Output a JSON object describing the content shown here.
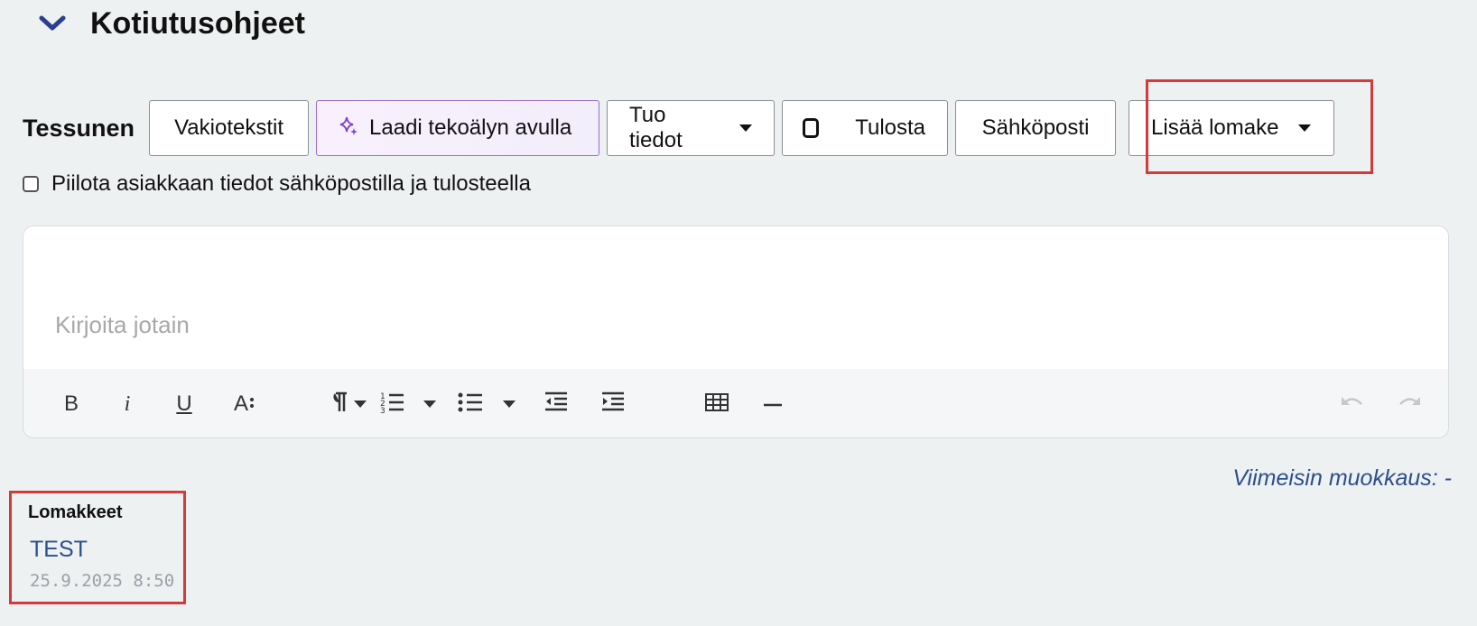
{
  "section": {
    "title": "Kotiutusohjeet",
    "toggle_icon": "chevron-down-icon"
  },
  "toolbar": {
    "label": "Tessunen",
    "buttons": {
      "standard_texts": "Vakiotekstit",
      "ai_compose": "Laadi tekoälyn avulla",
      "import_data": "Tuo tiedot",
      "print": "Tulosta",
      "email": "Sähköposti",
      "add_form": "Lisää lomake"
    }
  },
  "hide_client_info": {
    "label": "Piilota asiakkaan tiedot sähköpostilla ja tulosteella",
    "checked": false
  },
  "editor": {
    "placeholder": "Kirjoita jotain",
    "format_buttons": {
      "bold": "B",
      "italic": "i",
      "underline": "U",
      "font_size": "A"
    }
  },
  "last_edit": "Viimeisin muokkaus: -",
  "forms": {
    "title": "Lomakkeet",
    "items": [
      {
        "name": "TEST",
        "date": "25.9.2025 8:50"
      }
    ]
  },
  "colors": {
    "accent": "#2b4f8c",
    "highlight": "#d33a3a",
    "ai_icon": "#7b3fd0"
  }
}
